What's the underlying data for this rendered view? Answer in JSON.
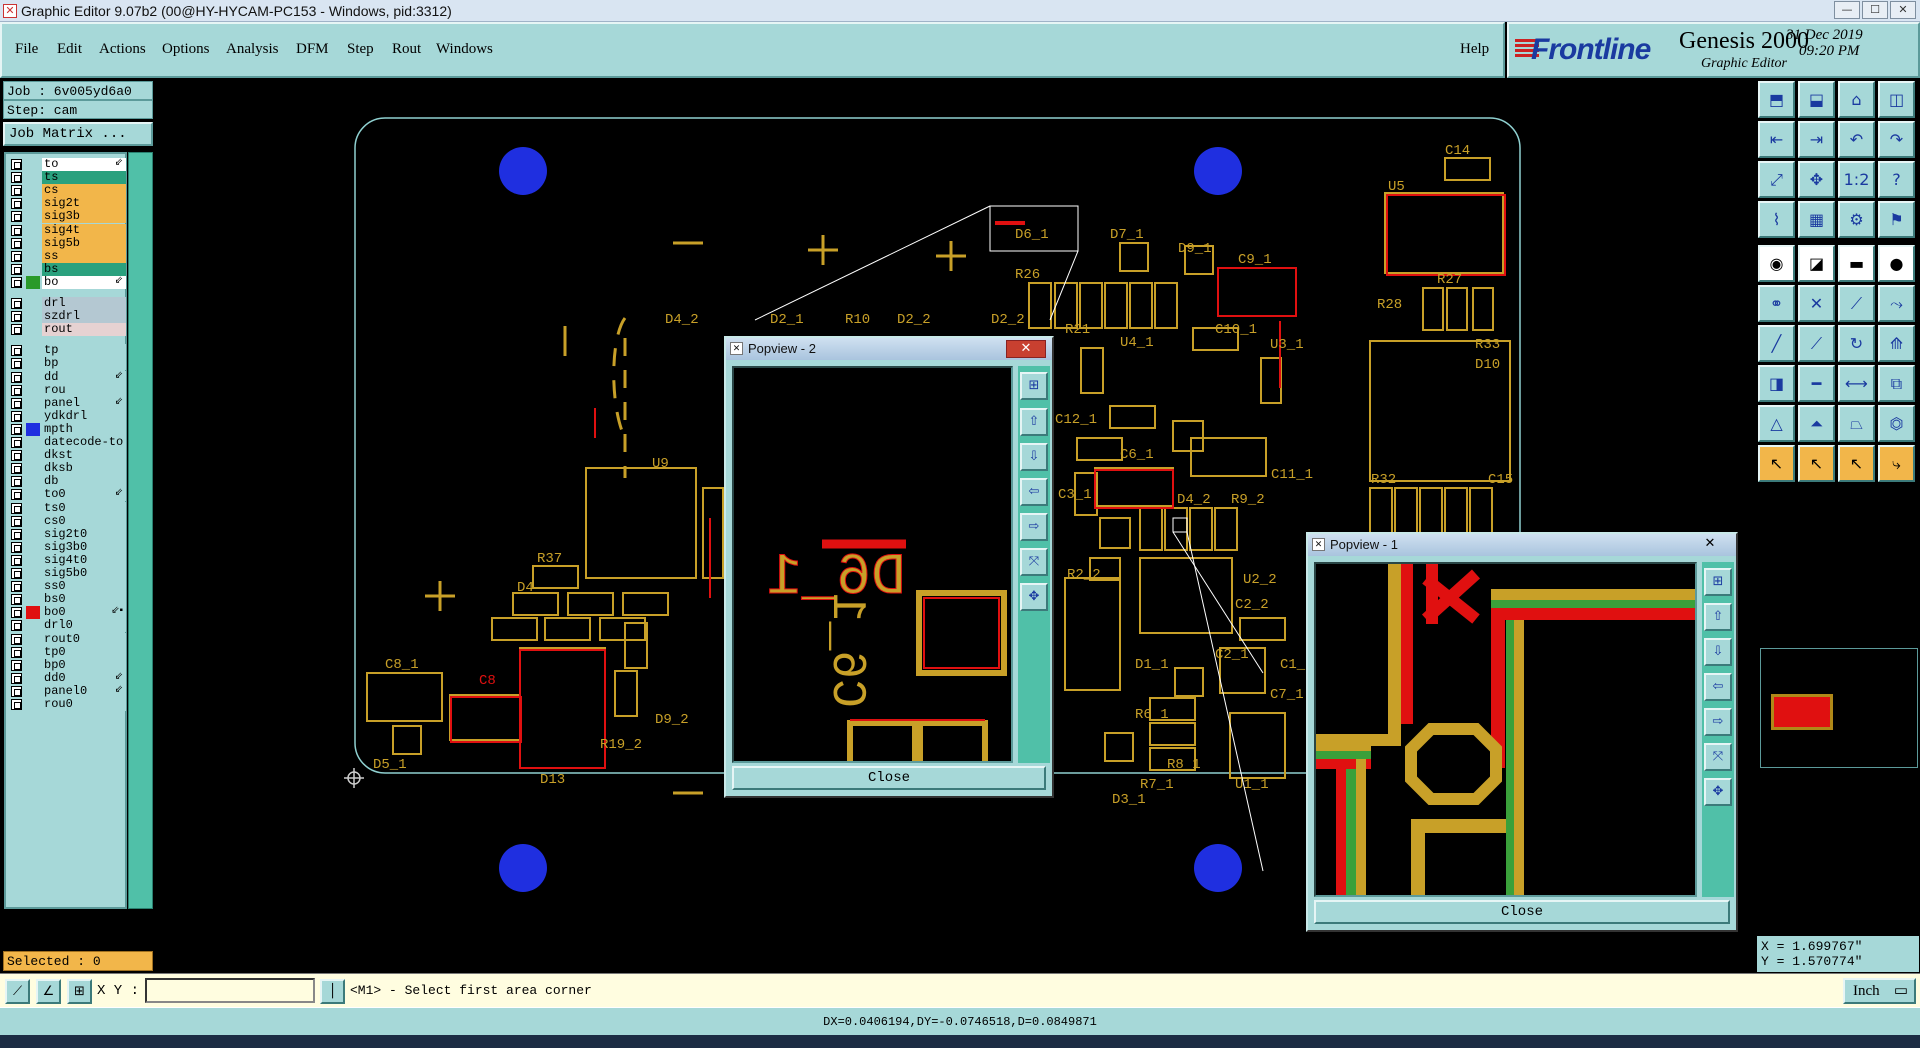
{
  "window": {
    "title": "Graphic Editor 9.07b2 (00@HY-HYCAM-PC153 - Windows, pid:3312)",
    "min_label": "—",
    "max_label": "☐",
    "close_label": "✕"
  },
  "menu": {
    "items": [
      "File",
      "Edit",
      "Actions",
      "Options",
      "Analysis",
      "DFM",
      "Step",
      "Rout",
      "Windows"
    ],
    "help": "Help"
  },
  "logo": {
    "brand": "Frontline",
    "product": "Genesis 2000",
    "subtitle": "Graphic Editor",
    "date": "31 Dec 2019",
    "time": "09:20 PM"
  },
  "job": {
    "job_line": "Job : 6v005yd6a0",
    "step_line": "Step: cam",
    "matrix_button": "Job Matrix ..."
  },
  "layers": [
    {
      "name": "to",
      "bg": "#ffffff",
      "sw": "",
      "flag": "⇙"
    },
    {
      "name": "ts",
      "bg": "#2aa17e",
      "sw": "",
      "flag": ""
    },
    {
      "name": "cs",
      "bg": "#f2b64a",
      "sw": "",
      "flag": ""
    },
    {
      "name": "sig2t",
      "bg": "#f2b64a",
      "sw": "",
      "flag": ""
    },
    {
      "name": "sig3b",
      "bg": "#f2b64a",
      "sw": "",
      "flag": ""
    },
    {
      "name": "sig4t",
      "bg": "#f2b64a",
      "sw": "",
      "flag": ""
    },
    {
      "name": "sig5b",
      "bg": "#f2b64a",
      "sw": "",
      "flag": ""
    },
    {
      "name": "ss",
      "bg": "#f2b64a",
      "sw": "",
      "flag": ""
    },
    {
      "name": "bs",
      "bg": "#2aa17e",
      "sw": "",
      "flag": ""
    },
    {
      "name": "bo",
      "bg": "#ffffff",
      "sw": "#2a9a2a",
      "flag": "⇙"
    },
    {
      "name": "drl",
      "bg": "#b4c8d2",
      "sw": "",
      "flag": ""
    },
    {
      "name": "szdrl",
      "bg": "#b4c8d2",
      "sw": "",
      "flag": ""
    },
    {
      "name": "rout",
      "bg": "#e6d2d2",
      "sw": "",
      "flag": ""
    },
    {
      "name": "tp",
      "bg": "#a6d8d8",
      "sw": "",
      "flag": ""
    },
    {
      "name": "bp",
      "bg": "#a6d8d8",
      "sw": "",
      "flag": ""
    },
    {
      "name": "dd",
      "bg": "#a6d8d8",
      "sw": "",
      "flag": "⇙"
    },
    {
      "name": "rou",
      "bg": "#a6d8d8",
      "sw": "",
      "flag": ""
    },
    {
      "name": "panel",
      "bg": "#a6d8d8",
      "sw": "",
      "flag": "⇙"
    },
    {
      "name": "ydkdrl",
      "bg": "#a6d8d8",
      "sw": "",
      "flag": ""
    },
    {
      "name": "mpth",
      "bg": "#a6d8d8",
      "sw": "#1f2fe0",
      "flag": ""
    },
    {
      "name": "datecode-to",
      "bg": "#a6d8d8",
      "sw": "",
      "flag": ""
    },
    {
      "name": "dkst",
      "bg": "#a6d8d8",
      "sw": "",
      "flag": ""
    },
    {
      "name": "dksb",
      "bg": "#a6d8d8",
      "sw": "",
      "flag": ""
    },
    {
      "name": "db",
      "bg": "#a6d8d8",
      "sw": "",
      "flag": ""
    },
    {
      "name": "to0",
      "bg": "#a6d8d8",
      "sw": "",
      "flag": "⇙"
    },
    {
      "name": "ts0",
      "bg": "#a6d8d8",
      "sw": "",
      "flag": ""
    },
    {
      "name": "cs0",
      "bg": "#a6d8d8",
      "sw": "",
      "flag": ""
    },
    {
      "name": "sig2t0",
      "bg": "#a6d8d8",
      "sw": "",
      "flag": ""
    },
    {
      "name": "sig3b0",
      "bg": "#a6d8d8",
      "sw": "",
      "flag": ""
    },
    {
      "name": "sig4t0",
      "bg": "#a6d8d8",
      "sw": "",
      "flag": ""
    },
    {
      "name": "sig5b0",
      "bg": "#a6d8d8",
      "sw": "",
      "flag": ""
    },
    {
      "name": "ss0",
      "bg": "#a6d8d8",
      "sw": "",
      "flag": ""
    },
    {
      "name": "bs0",
      "bg": "#a6d8d8",
      "sw": "",
      "flag": ""
    },
    {
      "name": "bo0",
      "bg": "#a6d8d8",
      "sw": "#e01010",
      "flag": "⇙▪"
    },
    {
      "name": "drl0",
      "bg": "#a6d8d8",
      "sw": "",
      "flag": ""
    },
    {
      "name": "rout0",
      "bg": "#a6d8d8",
      "sw": "",
      "flag": ""
    },
    {
      "name": "tp0",
      "bg": "#a6d8d8",
      "sw": "",
      "flag": ""
    },
    {
      "name": "bp0",
      "bg": "#a6d8d8",
      "sw": "",
      "flag": ""
    },
    {
      "name": "dd0",
      "bg": "#a6d8d8",
      "sw": "",
      "flag": "⇙"
    },
    {
      "name": "panel0",
      "bg": "#a6d8d8",
      "sw": "",
      "flag": "⇙"
    },
    {
      "name": "rou0",
      "bg": "#a6d8d8",
      "sw": "",
      "flag": ""
    }
  ],
  "selected_text": "Selected : 0",
  "board_labels": [
    "C14",
    "U5",
    "D7_1",
    "D9_1",
    "C9_1",
    "R28",
    "R27",
    "R33",
    "D10",
    "C10_1",
    "U3_1",
    "R21",
    "U4_1",
    "D4_2",
    "D2_1",
    "R10",
    "D2_2",
    "D2_2",
    "R26",
    "D6_1",
    "U9",
    "R37",
    "D4",
    "C8_1",
    "C8",
    "D5_1",
    "D13",
    "D9_2",
    "R19_2",
    "C12_1",
    "C11_1",
    "R32",
    "C15",
    "D4_2",
    "R9_2",
    "R2_2",
    "U2_2",
    "C2_2",
    "D1_1",
    "C2_1",
    "C1_1",
    "R6_1",
    "R8_1",
    "R7_1",
    "D3_1",
    "U1_1",
    "C7_1",
    "C6_1",
    "C3_1"
  ],
  "popview2": {
    "title": "Popview - 2",
    "close": "Close",
    "zoom_labels": [
      "D6_1",
      "C6_1"
    ]
  },
  "popview1": {
    "title": "Popview - 1",
    "close": "Close"
  },
  "tools": [
    "window-icon",
    "pan-icon",
    "home-icon",
    "layout-icon",
    "zoom-in-icon",
    "zoom-out-icon",
    "undo-icon",
    "redo-icon",
    "fit-icon",
    "center-icon",
    "scale-icon",
    "help-icon",
    "snap-icon",
    "grid-icon",
    "layers-icon",
    "net-icon",
    "drill-icon",
    "select-icon",
    "ruler-icon",
    "pad-icon",
    "connect-icon",
    "move-icon",
    "link-icon",
    "split-icon",
    "line-icon",
    "draw-icon",
    "arc-icon",
    "text-icon",
    "add-icon",
    "delete-icon",
    "measure-icon",
    "copy-icon",
    "poly-icon",
    "surface-icon",
    "arc3-icon",
    "arc4-icon",
    "cursor-icon",
    "cursor2-icon",
    "cursor3-icon",
    "flow-icon"
  ],
  "coords": {
    "x_line": "X = 1.699767\"",
    "y_line": "Y = 1.570774\""
  },
  "status": {
    "xy_label": "X Y :",
    "xy_value": "",
    "message": "<M1> - Select first area corner",
    "unit": "Inch"
  },
  "measure_line": "DX=0.0406194,DY=-0.0746518,D=0.0849871",
  "colors": {
    "panel": "#a6d8d8",
    "trace_gold": "#c8a028",
    "trace_red": "#e01010",
    "trace_green": "#3aa03a",
    "hole_blue": "#1f2fe0"
  }
}
